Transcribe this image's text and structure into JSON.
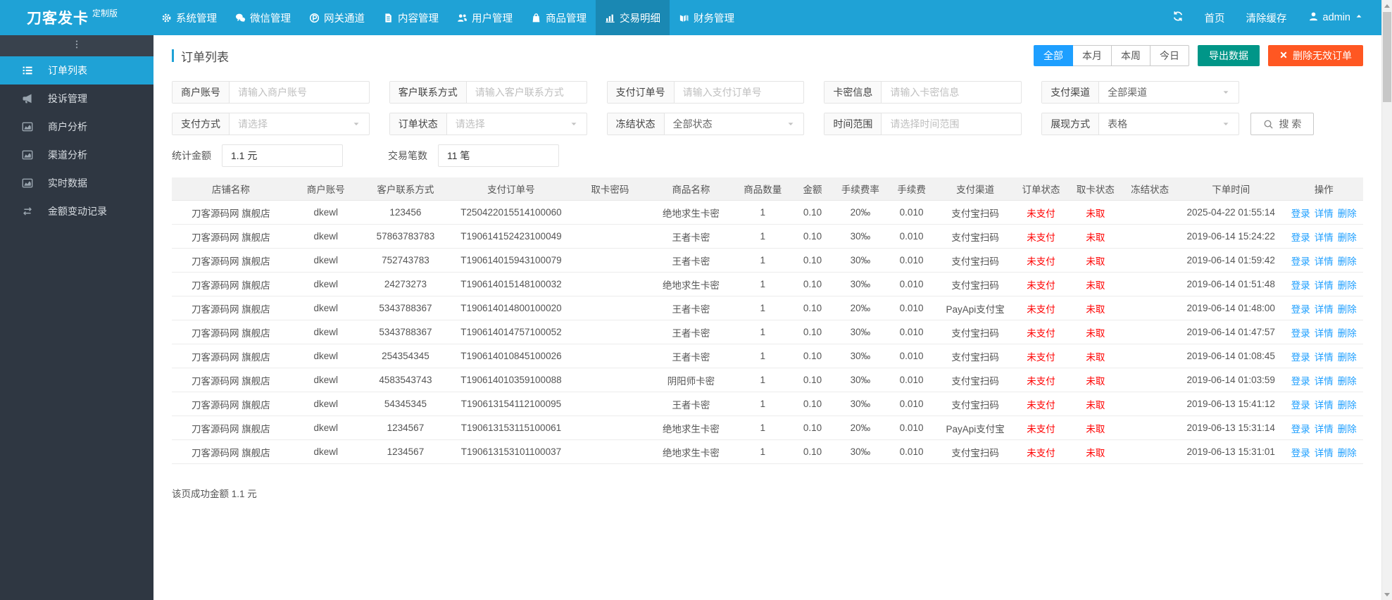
{
  "topbar": {
    "logo": "刀客发卡",
    "logo_badge": "定制版",
    "nav": [
      {
        "label": "系统管理",
        "icon": "gear-icon",
        "active": false
      },
      {
        "label": "微信管理",
        "icon": "wechat-icon",
        "active": false
      },
      {
        "label": "网关通道",
        "icon": "gateway-icon",
        "active": false
      },
      {
        "label": "内容管理",
        "icon": "content-icon",
        "active": false
      },
      {
        "label": "用户管理",
        "icon": "users-icon",
        "active": false
      },
      {
        "label": "商品管理",
        "icon": "goods-icon",
        "active": false
      },
      {
        "label": "交易明细",
        "icon": "bar-chart-icon",
        "active": true
      },
      {
        "label": "财务管理",
        "icon": "finance-icon",
        "active": false
      }
    ],
    "right": {
      "home": "首页",
      "clear_cache": "清除缓存",
      "user": "admin"
    }
  },
  "sidebar": {
    "items": [
      {
        "label": "订单列表",
        "icon": "ordered-list-icon",
        "active": true
      },
      {
        "label": "投诉管理",
        "icon": "megaphone-icon",
        "active": false
      },
      {
        "label": "商户分析",
        "icon": "area-chart-icon",
        "active": false
      },
      {
        "label": "渠道分析",
        "icon": "area-chart-icon",
        "active": false
      },
      {
        "label": "实时数据",
        "icon": "area-chart-icon",
        "active": false
      },
      {
        "label": "金额变动记录",
        "icon": "exchange-icon",
        "active": false
      }
    ]
  },
  "page": {
    "title": "订单列表",
    "range_buttons": [
      {
        "label": "全部",
        "active": true
      },
      {
        "label": "本月",
        "active": false
      },
      {
        "label": "本周",
        "active": false
      },
      {
        "label": "今日",
        "active": false
      }
    ],
    "export_button": "导出数据",
    "delete_button": "删除无效订单"
  },
  "filters": {
    "row1": [
      {
        "label": "商户账号",
        "type": "input",
        "placeholder": "请输入商户账号"
      },
      {
        "label": "客户联系方式",
        "type": "input",
        "placeholder": "请输入客户联系方式"
      },
      {
        "label": "支付订单号",
        "type": "input",
        "placeholder": "请输入支付订单号"
      },
      {
        "label": "卡密信息",
        "type": "input",
        "placeholder": "请输入卡密信息"
      },
      {
        "label": "支付渠道",
        "type": "select",
        "value": "全部渠道",
        "is_placeholder": false
      }
    ],
    "row2": [
      {
        "label": "支付方式",
        "type": "select",
        "value": "请选择",
        "is_placeholder": true
      },
      {
        "label": "订单状态",
        "type": "select",
        "value": "请选择",
        "is_placeholder": true
      },
      {
        "label": "冻结状态",
        "type": "select",
        "value": "全部状态",
        "is_placeholder": false
      },
      {
        "label": "时间范围",
        "type": "input",
        "placeholder": "请选择时间范围"
      },
      {
        "label": "展现方式",
        "type": "select",
        "value": "表格",
        "is_placeholder": false
      }
    ],
    "search_button": "搜 索",
    "stats": [
      {
        "label": "统计金额",
        "value": "1.1 元"
      },
      {
        "label": "交易笔数",
        "value": "11 笔"
      }
    ]
  },
  "table": {
    "columns": [
      "店铺名称",
      "商户账号",
      "客户联系方式",
      "支付订单号",
      "取卡密码",
      "商品名称",
      "商品数量",
      "金额",
      "手续费率",
      "手续费",
      "支付渠道",
      "订单状态",
      "取卡状态",
      "冻结状态",
      "下单时间",
      "操作"
    ],
    "ops": [
      "登录",
      "详情",
      "删除"
    ],
    "rows": [
      {
        "shop": "刀客源码网 旗舰店",
        "merchant": "dkewl",
        "contact": "123456",
        "order_no": "T250422015514100060",
        "card_pwd": "",
        "product": "绝地求生卡密",
        "qty": "1",
        "amount": "0.10",
        "fee_rate": "20‰",
        "fee": "0.010",
        "channel": "支付宝扫码",
        "order_status": "未支付",
        "card_status": "未取",
        "freeze_status": "",
        "time": "2025-04-22 01:55:14"
      },
      {
        "shop": "刀客源码网 旗舰店",
        "merchant": "dkewl",
        "contact": "57863783783",
        "order_no": "T190614152423100049",
        "card_pwd": "",
        "product": "王者卡密",
        "qty": "1",
        "amount": "0.10",
        "fee_rate": "30‰",
        "fee": "0.010",
        "channel": "支付宝扫码",
        "order_status": "未支付",
        "card_status": "未取",
        "freeze_status": "",
        "time": "2019-06-14 15:24:22"
      },
      {
        "shop": "刀客源码网 旗舰店",
        "merchant": "dkewl",
        "contact": "752743783",
        "order_no": "T190614015943100079",
        "card_pwd": "",
        "product": "王者卡密",
        "qty": "1",
        "amount": "0.10",
        "fee_rate": "30‰",
        "fee": "0.010",
        "channel": "支付宝扫码",
        "order_status": "未支付",
        "card_status": "未取",
        "freeze_status": "",
        "time": "2019-06-14 01:59:42"
      },
      {
        "shop": "刀客源码网 旗舰店",
        "merchant": "dkewl",
        "contact": "24273273",
        "order_no": "T190614015148100032",
        "card_pwd": "",
        "product": "绝地求生卡密",
        "qty": "1",
        "amount": "0.10",
        "fee_rate": "30‰",
        "fee": "0.010",
        "channel": "支付宝扫码",
        "order_status": "未支付",
        "card_status": "未取",
        "freeze_status": "",
        "time": "2019-06-14 01:51:48"
      },
      {
        "shop": "刀客源码网 旗舰店",
        "merchant": "dkewl",
        "contact": "5343788367",
        "order_no": "T190614014800100020",
        "card_pwd": "",
        "product": "王者卡密",
        "qty": "1",
        "amount": "0.10",
        "fee_rate": "20‰",
        "fee": "0.010",
        "channel": "PayApi支付宝",
        "order_status": "未支付",
        "card_status": "未取",
        "freeze_status": "",
        "time": "2019-06-14 01:48:00"
      },
      {
        "shop": "刀客源码网 旗舰店",
        "merchant": "dkewl",
        "contact": "5343788367",
        "order_no": "T190614014757100052",
        "card_pwd": "",
        "product": "王者卡密",
        "qty": "1",
        "amount": "0.10",
        "fee_rate": "30‰",
        "fee": "0.010",
        "channel": "支付宝扫码",
        "order_status": "未支付",
        "card_status": "未取",
        "freeze_status": "",
        "time": "2019-06-14 01:47:57"
      },
      {
        "shop": "刀客源码网 旗舰店",
        "merchant": "dkewl",
        "contact": "254354345",
        "order_no": "T190614010845100026",
        "card_pwd": "",
        "product": "王者卡密",
        "qty": "1",
        "amount": "0.10",
        "fee_rate": "30‰",
        "fee": "0.010",
        "channel": "支付宝扫码",
        "order_status": "未支付",
        "card_status": "未取",
        "freeze_status": "",
        "time": "2019-06-14 01:08:45"
      },
      {
        "shop": "刀客源码网 旗舰店",
        "merchant": "dkewl",
        "contact": "4583543743",
        "order_no": "T190614010359100088",
        "card_pwd": "",
        "product": "阴阳师卡密",
        "qty": "1",
        "amount": "0.10",
        "fee_rate": "30‰",
        "fee": "0.010",
        "channel": "支付宝扫码",
        "order_status": "未支付",
        "card_status": "未取",
        "freeze_status": "",
        "time": "2019-06-14 01:03:59"
      },
      {
        "shop": "刀客源码网 旗舰店",
        "merchant": "dkewl",
        "contact": "54345345",
        "order_no": "T190613154112100095",
        "card_pwd": "",
        "product": "王者卡密",
        "qty": "1",
        "amount": "0.10",
        "fee_rate": "30‰",
        "fee": "0.010",
        "channel": "支付宝扫码",
        "order_status": "未支付",
        "card_status": "未取",
        "freeze_status": "",
        "time": "2019-06-13 15:41:12"
      },
      {
        "shop": "刀客源码网 旗舰店",
        "merchant": "dkewl",
        "contact": "1234567",
        "order_no": "T190613153115100061",
        "card_pwd": "",
        "product": "绝地求生卡密",
        "qty": "1",
        "amount": "0.10",
        "fee_rate": "20‰",
        "fee": "0.010",
        "channel": "PayApi支付宝",
        "order_status": "未支付",
        "card_status": "未取",
        "freeze_status": "",
        "time": "2019-06-13 15:31:14"
      },
      {
        "shop": "刀客源码网 旗舰店",
        "merchant": "dkewl",
        "contact": "1234567",
        "order_no": "T190613153101100037",
        "card_pwd": "",
        "product": "绝地求生卡密",
        "qty": "1",
        "amount": "0.10",
        "fee_rate": "30‰",
        "fee": "0.010",
        "channel": "支付宝扫码",
        "order_status": "未支付",
        "card_status": "未取",
        "freeze_status": "",
        "time": "2019-06-13 15:31:01"
      }
    ],
    "footer": "该页成功金额 1.1 元"
  },
  "colors": {
    "topbar": "#1FA2D6",
    "sidebar": "#2F3742",
    "active_range_button": "#1E9FFF",
    "export_button": "#009688",
    "delete_button": "#FF5722",
    "status_red": "#FF0000",
    "link_blue": "#1E9FFF"
  }
}
